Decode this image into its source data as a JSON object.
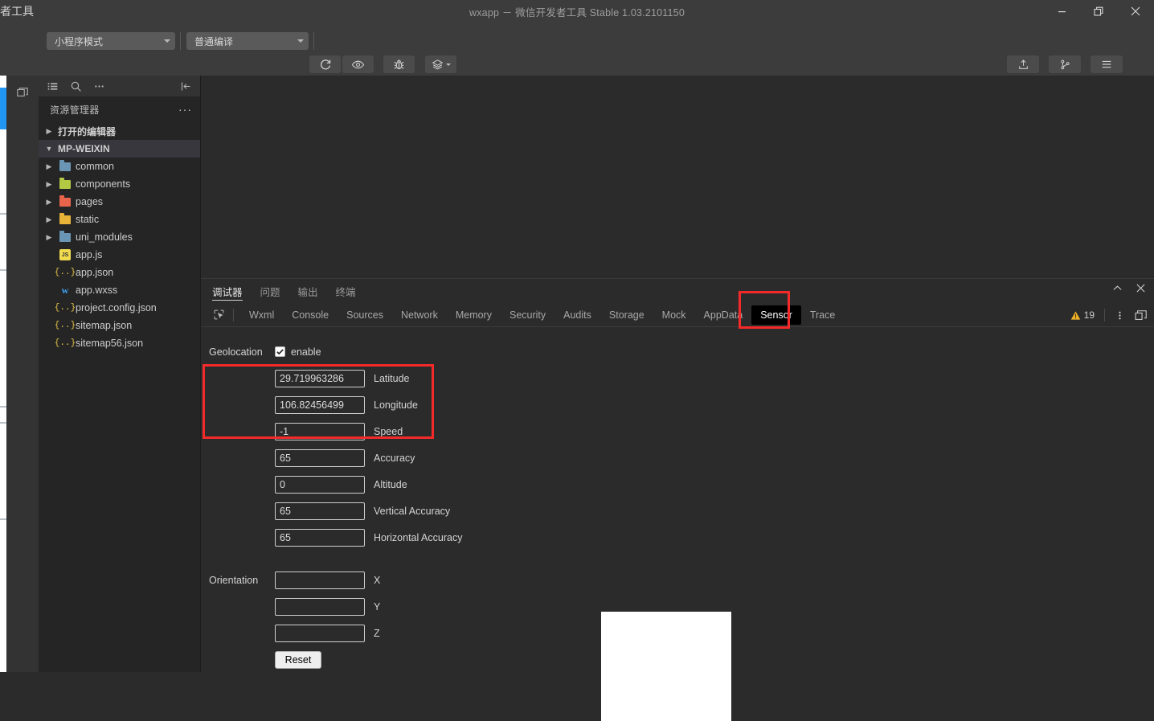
{
  "window": {
    "background_app_label": "者工具",
    "title": "wxapp － 微信开发者工具 Stable 1.03.2101150",
    "controls": {
      "minimize": "minimize-icon",
      "restore": "restore-icon",
      "close": "close-icon"
    }
  },
  "toolbar": {
    "mode_select": "小程序模式",
    "compile_select": "普通编译",
    "buttons": [
      {
        "label": "编译",
        "icon": "refresh-icon"
      },
      {
        "label": "预览",
        "icon": "eye-icon"
      },
      {
        "label": "真机调试",
        "icon": "bug-icon"
      },
      {
        "label": "清缓存",
        "icon": "layers-icon"
      }
    ],
    "right_buttons": [
      {
        "label": "上传",
        "icon": "upload-icon"
      },
      {
        "label": "版本管理",
        "icon": "git-branch-icon"
      },
      {
        "label": "详情",
        "icon": "hamburger-icon"
      }
    ]
  },
  "activity_bar": {
    "items": [
      {
        "icon": "simulator-icon"
      }
    ]
  },
  "sidebar": {
    "top_icons": [
      {
        "icon": "list-icon"
      },
      {
        "icon": "search-icon"
      },
      {
        "icon": "more-icon"
      },
      {
        "icon": "collapse-panel-icon"
      }
    ],
    "title": "资源管理器",
    "title_more": "···",
    "sections": [
      {
        "label": "打开的编辑器",
        "expanded": false
      },
      {
        "label": "MP-WEIXIN",
        "expanded": true
      }
    ],
    "files": [
      {
        "name": "common",
        "type": "folder",
        "color": "#6a95b5",
        "expandable": true
      },
      {
        "name": "components",
        "type": "folder",
        "color": "#b3c944",
        "expandable": true
      },
      {
        "name": "pages",
        "type": "folder",
        "color": "#e8644a",
        "expandable": true
      },
      {
        "name": "static",
        "type": "folder",
        "color": "#e8b339",
        "expandable": true
      },
      {
        "name": "uni_modules",
        "type": "folder",
        "color": "#6a95b5",
        "expandable": true
      },
      {
        "name": "app.js",
        "type": "js",
        "expandable": false
      },
      {
        "name": "app.json",
        "type": "json",
        "expandable": false
      },
      {
        "name": "app.wxss",
        "type": "css",
        "expandable": false
      },
      {
        "name": "project.config.json",
        "type": "json",
        "expandable": false
      },
      {
        "name": "sitemap.json",
        "type": "json",
        "expandable": false
      },
      {
        "name": "sitemap56.json",
        "type": "json",
        "expandable": false
      }
    ]
  },
  "panel": {
    "tabs": [
      {
        "label": "调试器",
        "active": true
      },
      {
        "label": "问题",
        "active": false
      },
      {
        "label": "输出",
        "active": false
      },
      {
        "label": "终端",
        "active": false
      }
    ],
    "actions": [
      {
        "icon": "chevron-up-icon"
      },
      {
        "icon": "close-icon"
      }
    ],
    "devtools": {
      "inspect_icon": "inspect-element-icon",
      "tabs": [
        {
          "label": "Wxml",
          "active": false
        },
        {
          "label": "Console",
          "active": false
        },
        {
          "label": "Sources",
          "active": false
        },
        {
          "label": "Network",
          "active": false
        },
        {
          "label": "Memory",
          "active": false
        },
        {
          "label": "Security",
          "active": false
        },
        {
          "label": "Audits",
          "active": false
        },
        {
          "label": "Storage",
          "active": false
        },
        {
          "label": "Mock",
          "active": false
        },
        {
          "label": "AppData",
          "active": false
        },
        {
          "label": "Sensor",
          "active": true
        },
        {
          "label": "Trace",
          "active": false
        }
      ],
      "warning_count": "19",
      "warning_icon": "warning-triangle-icon",
      "kebab_icon": "more-vertical-icon",
      "dock_icon": "dock-layout-icon"
    }
  },
  "sensor": {
    "geolocation": {
      "section_label": "Geolocation",
      "enable_label": "enable",
      "enabled": true,
      "fields": [
        {
          "value": "29.719963286",
          "label": "Latitude"
        },
        {
          "value": "106.82456499",
          "label": "Longitude"
        },
        {
          "value": "-1",
          "label": "Speed"
        },
        {
          "value": "65",
          "label": "Accuracy"
        },
        {
          "value": "0",
          "label": "Altitude"
        },
        {
          "value": "65",
          "label": "Vertical Accuracy"
        },
        {
          "value": "65",
          "label": "Horizontal Accuracy"
        }
      ]
    },
    "orientation": {
      "section_label": "Orientation",
      "fields": [
        {
          "value": "",
          "label": "X"
        },
        {
          "value": "",
          "label": "Y"
        },
        {
          "value": "",
          "label": "Z"
        }
      ],
      "reset_label": "Reset"
    }
  },
  "highlights": {
    "color": "#f42a2a",
    "regions": [
      "sensor-tab",
      "geolocation-coords"
    ]
  }
}
